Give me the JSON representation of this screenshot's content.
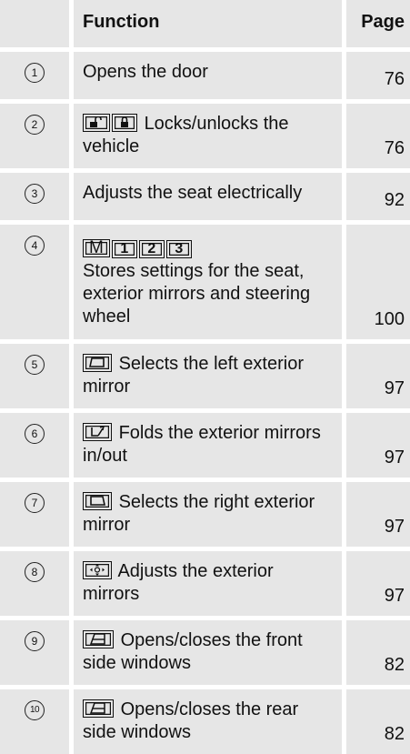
{
  "header": {
    "function_label": "Function",
    "page_label": "Page"
  },
  "rows": [
    {
      "num": "1",
      "text": "Opens the door",
      "page": "76"
    },
    {
      "num": "2",
      "text": "Locks/unlocks the vehicle",
      "page": "76",
      "icons": [
        "unlock-icon",
        "lock-icon"
      ]
    },
    {
      "num": "3",
      "text": "Adjusts the seat electrically",
      "page": "92"
    },
    {
      "num": "4",
      "text": "Stores settings for the seat, exterior mirrors and steering wheel",
      "page": "100",
      "keys": [
        "M",
        "1",
        "2",
        "3"
      ]
    },
    {
      "num": "5",
      "text": "Selects the left exterior mirror",
      "page": "97",
      "icons": [
        "left-mirror-icon"
      ]
    },
    {
      "num": "6",
      "text": "Folds the exterior mirrors in/out",
      "page": "97",
      "icons": [
        "mirror-fold-icon"
      ]
    },
    {
      "num": "7",
      "text": "Selects the right exterior mirror",
      "page": "97",
      "icons": [
        "right-mirror-icon"
      ]
    },
    {
      "num": "8",
      "text": "Adjusts the exterior mirrors",
      "page": "97",
      "icons": [
        "mirror-adjust-icon"
      ]
    },
    {
      "num": "9",
      "text": "Opens/closes the front side windows",
      "page": "82",
      "icons": [
        "window-switch-icon"
      ]
    },
    {
      "num": "10",
      "text": "Opens/closes the rear side windows",
      "page": "82",
      "icons": [
        "window-switch-icon"
      ]
    }
  ]
}
